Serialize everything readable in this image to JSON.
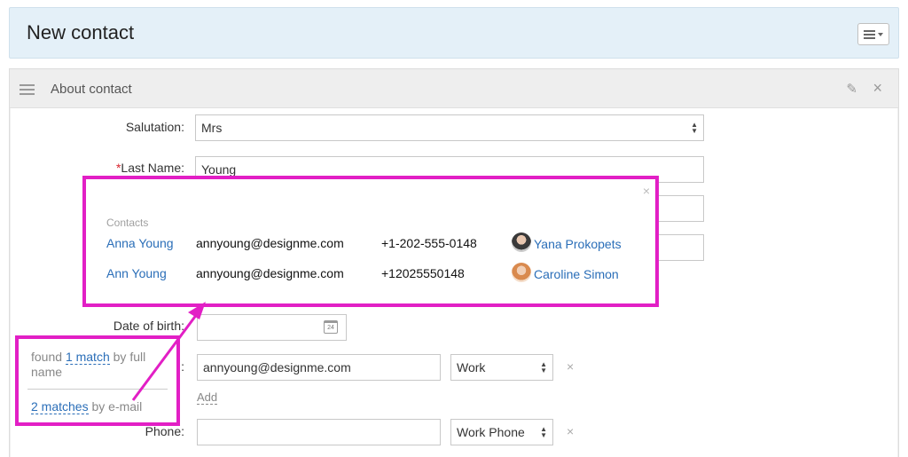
{
  "header": {
    "title": "New contact"
  },
  "section": {
    "title": "About contact"
  },
  "form": {
    "salutation_label": "Salutation:",
    "salutation_value": "Mrs",
    "last_name_required": "*",
    "last_name_label": "Last Name:",
    "last_name_value": "Young",
    "dob_label": "Date of birth:",
    "email_label": ":",
    "email_value": "annyoung@designme.com",
    "email_type": "Work",
    "add_label": "Add",
    "phone_label": "Phone:",
    "phone_value": "",
    "phone_type": "Work Phone",
    "calendar_day": "24"
  },
  "popup": {
    "heading": "Contacts",
    "rows": [
      {
        "name": "Anna Young",
        "email": "annyoung@designme.com",
        "phone": "+1-202-555-0148",
        "owner": "Yana Prokopets"
      },
      {
        "name": "Ann Young",
        "email": "annyoung@designme.com",
        "phone": "+12025550148",
        "owner": "Caroline Simon"
      }
    ]
  },
  "annotation": {
    "found": "found",
    "match_link": "1 match",
    "by_full_name": "by full name",
    "matches_link": "2 matches",
    "by_email": "by e-mail"
  },
  "colors": {
    "highlight": "#e21fc5",
    "link": "#2a6eb8",
    "header_bg": "#e4f0f8"
  }
}
